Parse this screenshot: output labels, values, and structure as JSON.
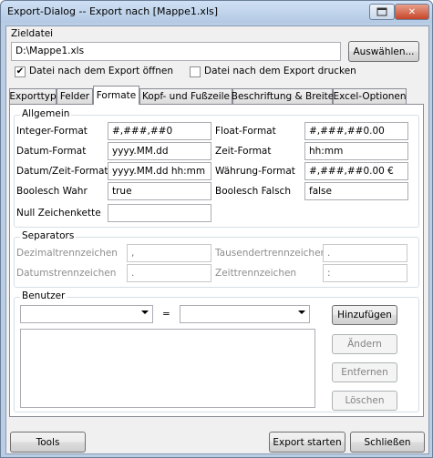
{
  "window": {
    "title": "Export-Dialog -- Export nach [Mappe1.xls]"
  },
  "target": {
    "label": "Zieldatei",
    "path": "D:\\Mappe1.xls",
    "browse_label": "Auswählen...",
    "open_after_label": "Datei nach dem Export öffnen",
    "open_after_checked": true,
    "print_after_label": "Datei nach dem Export drucken",
    "print_after_checked": false
  },
  "tabs": [
    "Exporttyp",
    "Felder",
    "Formate",
    "Kopf- und Fußzeile",
    "Beschriftung & Breite",
    "Excel-Optionen"
  ],
  "active_tab": "Formate",
  "allgemein": {
    "title": "Allgemein",
    "integer_label": "Integer-Format",
    "integer_value": "#,###,##0",
    "float_label": "Float-Format",
    "float_value": "#,###,##0.00",
    "date_label": "Datum-Format",
    "date_value": "yyyy.MM.dd",
    "time_label": "Zeit-Format",
    "time_value": "hh:mm",
    "datetime_label": "Datum/Zeit-Format",
    "datetime_value": "yyyy.MM.dd  hh:mm",
    "currency_label": "Währung-Format",
    "currency_value": "#,###,##0.00 €",
    "bool_true_label": "Boolesch Wahr",
    "bool_true_value": "true",
    "bool_false_label": "Boolesch Falsch",
    "bool_false_value": "false",
    "null_label": "Null Zeichenkette",
    "null_value": ""
  },
  "separators": {
    "title": "Separators",
    "decimal_label": "Dezimaltrennzeichen",
    "decimal_value": ",",
    "thousand_label": "Tausendertrennzeichen",
    "thousand_value": ".",
    "date_label": "Datumstrennzeichen",
    "date_value": ".",
    "time_label": "Zeittrennzeichen",
    "time_value": ":"
  },
  "benutzer": {
    "title": "Benutzer",
    "equals": "=",
    "add_label": "Hinzufügen",
    "change_label": "Ändern",
    "remove_label": "Entfernen",
    "clear_label": "Löschen"
  },
  "footer": {
    "tools_label": "Tools",
    "export_label": "Export starten",
    "close_label": "Schließen"
  }
}
